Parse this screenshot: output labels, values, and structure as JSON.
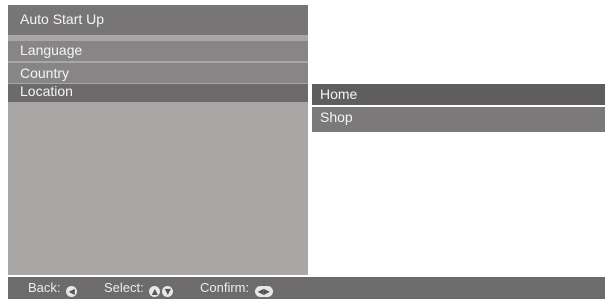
{
  "menu": {
    "title": "Auto Start Up",
    "items": [
      {
        "label": "Language"
      },
      {
        "label": "Country"
      },
      {
        "label": "Location",
        "selected": true
      }
    ]
  },
  "submenu": {
    "items": [
      {
        "label": "Home",
        "selected": true
      },
      {
        "label": "Shop"
      }
    ]
  },
  "footer": {
    "back_label": "Back:",
    "back_icon": "back-arrow-icon",
    "select_label": "Select:",
    "select_icons": [
      "arrow-up-icon",
      "arrow-down-icon"
    ],
    "confirm_label": "Confirm:",
    "confirm_icon": "left-right-arrow-icon"
  },
  "colors": {
    "title_bar": "#777575",
    "panel": "#a9a7a6",
    "item": "#878585",
    "item_selected": "#6c6a6a",
    "submenu_selected": "#5f5d5d",
    "submenu_item": "#7b7979",
    "footer": "#6d6b6b",
    "text": "#f4f4f4"
  }
}
